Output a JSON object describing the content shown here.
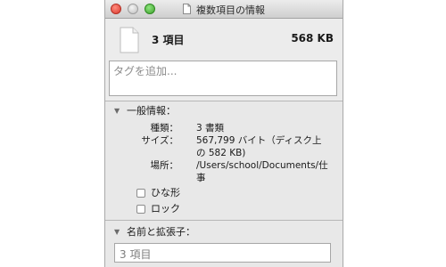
{
  "window": {
    "title": "複数項目の情報",
    "title_icon": "document-icon"
  },
  "summary": {
    "item_count": "3 項目",
    "size": "568 KB",
    "icon": "document-icon"
  },
  "tags": {
    "placeholder": "タグを追加..."
  },
  "general": {
    "header": "一般情報：",
    "rows": [
      {
        "label": "種類：",
        "value": "3 書類"
      },
      {
        "label": "サイズ：",
        "value": "567,799 バイト（ディスク上の 582 KB)"
      },
      {
        "label": "場所：",
        "value": "/Users/school/Documents/仕事"
      }
    ],
    "checkboxes": [
      {
        "label": "ひな形",
        "checked": false
      },
      {
        "label": "ロック",
        "checked": false
      }
    ]
  },
  "name_ext": {
    "header": "名前と拡張子：",
    "value": "3 項目"
  }
}
